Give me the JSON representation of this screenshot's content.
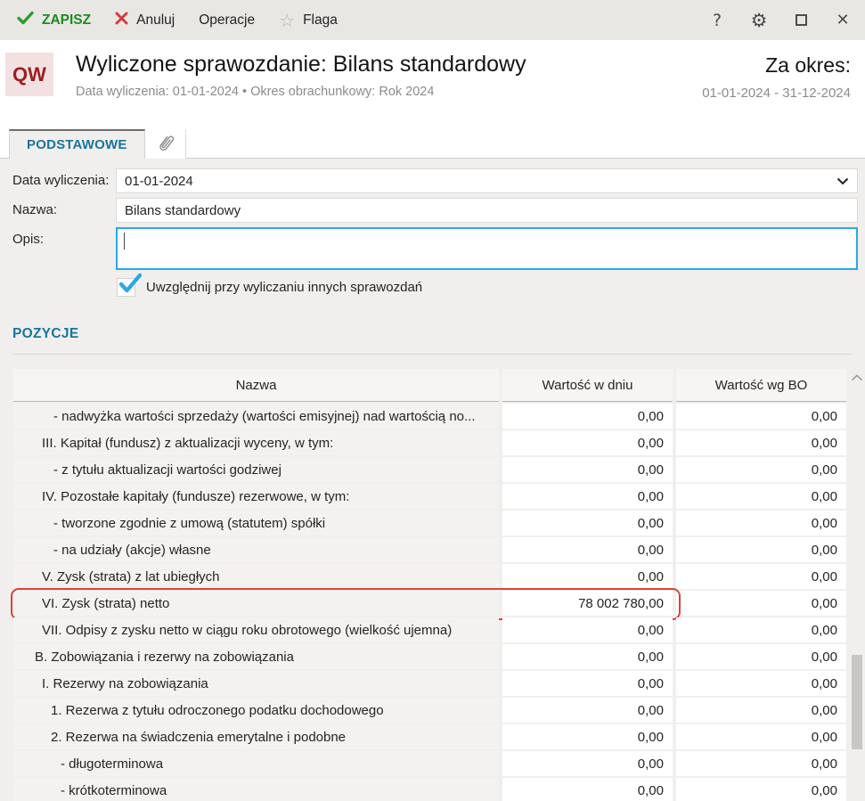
{
  "colors": {
    "accent_blue": "#17759e",
    "check_blue": "#2aa9e0",
    "save_green": "#1f8a1f",
    "cancel_red": "#d43c3c",
    "highlight_red": "#d6453b",
    "badge_red": "#9a2020",
    "badge_bg": "#f3e1e1"
  },
  "toolbar": {
    "save_label": "ZAPISZ",
    "cancel_label": "Anuluj",
    "operations_label": "Operacje",
    "flag_label": "Flaga",
    "help_glyph": "?"
  },
  "header": {
    "badge": "QW",
    "title": "Wyliczone sprawozdanie: Bilans standardowy",
    "subtitle": "Data wyliczenia: 01-01-2024  •  Okres obrachunkowy: Rok 2024",
    "period_title": "Za okres:",
    "period_range": "01-01-2024 - 31-12-2024"
  },
  "tabs": {
    "basic_label": "PODSTAWOWE"
  },
  "form": {
    "date_label": "Data wyliczenia:",
    "date_value": "01-01-2024",
    "name_label": "Nazwa:",
    "name_value": "Bilans standardowy",
    "desc_label": "Opis:",
    "desc_value": "",
    "checkbox_label": "Uwzględnij przy wyliczaniu innych sprawozdań",
    "checkbox_checked": true
  },
  "section": {
    "title": "POZYCJE"
  },
  "table": {
    "columns": [
      "Nazwa",
      "Wartość w dniu",
      "Wartość wg BO"
    ],
    "rows": [
      {
        "name": "- nadwyżka wartości sprzedaży (wartości emisyjnej) nad wartością no...",
        "level": 3,
        "value_day": "0,00",
        "value_bo": "0,00",
        "highlight": false
      },
      {
        "name": "III. Kapitał (fundusz) z aktualizacji wyceny, w tym:",
        "level": 1,
        "value_day": "0,00",
        "value_bo": "0,00",
        "highlight": false
      },
      {
        "name": "- z tytułu aktualizacji wartości godziwej",
        "level": 3,
        "value_day": "0,00",
        "value_bo": "0,00",
        "highlight": false
      },
      {
        "name": "IV. Pozostałe kapitały (fundusze) rezerwowe, w tym:",
        "level": 1,
        "value_day": "0,00",
        "value_bo": "0,00",
        "highlight": false
      },
      {
        "name": "- tworzone zgodnie z umową (statutem) spółki",
        "level": 3,
        "value_day": "0,00",
        "value_bo": "0,00",
        "highlight": false
      },
      {
        "name": "- na udziały (akcje) własne",
        "level": 3,
        "value_day": "0,00",
        "value_bo": "0,00",
        "highlight": false
      },
      {
        "name": "V. Zysk (strata) z lat ubiegłych",
        "level": 1,
        "value_day": "0,00",
        "value_bo": "0,00",
        "highlight": false
      },
      {
        "name": "VI. Zysk (strata) netto",
        "level": 1,
        "value_day": "78 002 780,00",
        "value_bo": "0,00",
        "highlight": true
      },
      {
        "name": "VII. Odpisy z zysku netto w ciągu roku obrotowego (wielkość ujemna)",
        "level": 1,
        "value_day": "0,00",
        "value_bo": "0,00",
        "highlight": false
      },
      {
        "name": "B. Zobowiązania i rezerwy na zobowiązania",
        "level": 0,
        "value_day": "0,00",
        "value_bo": "0,00",
        "highlight": false
      },
      {
        "name": "I. Rezerwy na zobowiązania",
        "level": 1,
        "value_day": "0,00",
        "value_bo": "0,00",
        "highlight": false
      },
      {
        "name": "1. Rezerwa z tytułu odroczonego podatku dochodowego",
        "level": 2,
        "value_day": "0,00",
        "value_bo": "0,00",
        "highlight": false
      },
      {
        "name": "2. Rezerwa na świadczenia emerytalne i podobne",
        "level": 2,
        "value_day": "0,00",
        "value_bo": "0,00",
        "highlight": false
      },
      {
        "name": "- długoterminowa",
        "level": 4,
        "value_day": "0,00",
        "value_bo": "0,00",
        "highlight": false
      },
      {
        "name": "- krótkoterminowa",
        "level": 4,
        "value_day": "0,00",
        "value_bo": "0,00",
        "highlight": false
      }
    ]
  }
}
